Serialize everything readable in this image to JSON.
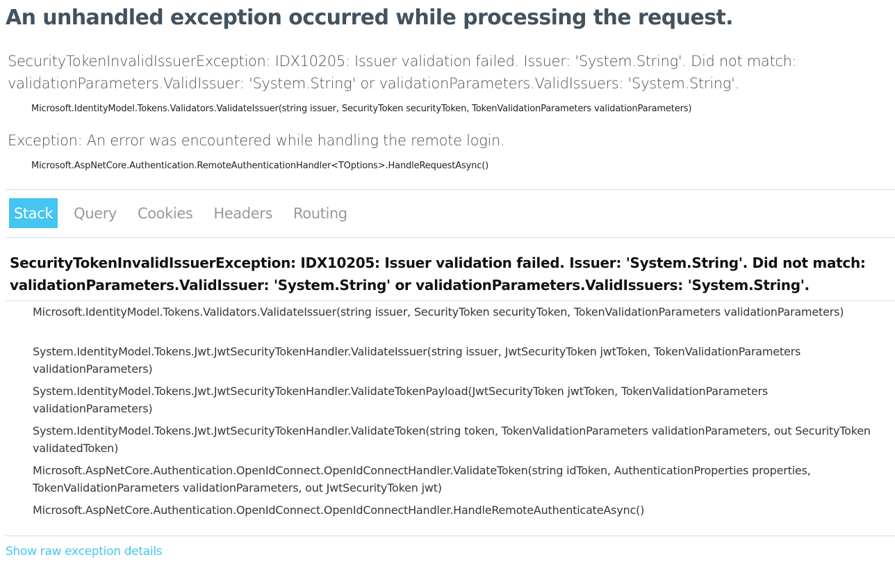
{
  "page": {
    "title": "An unhandled exception occurred while processing the request."
  },
  "exceptions": [
    {
      "message": "SecurityTokenInvalidIssuerException: IDX10205: Issuer validation failed. Issuer: 'System.String'. Did not match: validationParameters.ValidIssuer: 'System.String' or validationParameters.ValidIssuers: 'System.String'.",
      "location": "Microsoft.IdentityModel.Tokens.Validators.ValidateIssuer(string issuer, SecurityToken securityToken, TokenValidationParameters validationParameters)"
    },
    {
      "message": "Exception: An error was encountered while handling the remote login.",
      "location": "Microsoft.AspNetCore.Authentication.RemoteAuthenticationHandler<TOptions>.HandleRequestAsync()"
    }
  ],
  "tabs": [
    {
      "label": "Stack",
      "active": true
    },
    {
      "label": "Query",
      "active": false
    },
    {
      "label": "Cookies",
      "active": false
    },
    {
      "label": "Headers",
      "active": false
    },
    {
      "label": "Routing",
      "active": false
    }
  ],
  "stack": {
    "title": "SecurityTokenInvalidIssuerException: IDX10205: Issuer validation failed. Issuer: 'System.String'. Did not match: validationParameters.ValidIssuer: 'System.String' or validationParameters.ValidIssuers: 'System.String'.",
    "frames": [
      "Microsoft.IdentityModel.Tokens.Validators.ValidateIssuer(string issuer, SecurityToken securityToken, TokenValidationParameters validationParameters)",
      "System.IdentityModel.Tokens.Jwt.JwtSecurityTokenHandler.ValidateIssuer(string issuer, JwtSecurityToken jwtToken, TokenValidationParameters validationParameters)",
      "System.IdentityModel.Tokens.Jwt.JwtSecurityTokenHandler.ValidateTokenPayload(JwtSecurityToken jwtToken, TokenValidationParameters validationParameters)",
      "System.IdentityModel.Tokens.Jwt.JwtSecurityTokenHandler.ValidateToken(string token, TokenValidationParameters validationParameters, out SecurityToken validatedToken)",
      "Microsoft.AspNetCore.Authentication.OpenIdConnect.OpenIdConnectHandler.ValidateToken(string idToken, AuthenticationProperties properties, TokenValidationParameters validationParameters, out JwtSecurityToken jwt)",
      "Microsoft.AspNetCore.Authentication.OpenIdConnect.OpenIdConnectHandler.HandleRemoteAuthenticateAsync()"
    ]
  },
  "links": {
    "raw_details": "Show raw exception details"
  },
  "colors": {
    "title": "#44525e",
    "accent": "#44c5f2",
    "tab_inactive": "#999999",
    "divider": "#dddddd"
  }
}
